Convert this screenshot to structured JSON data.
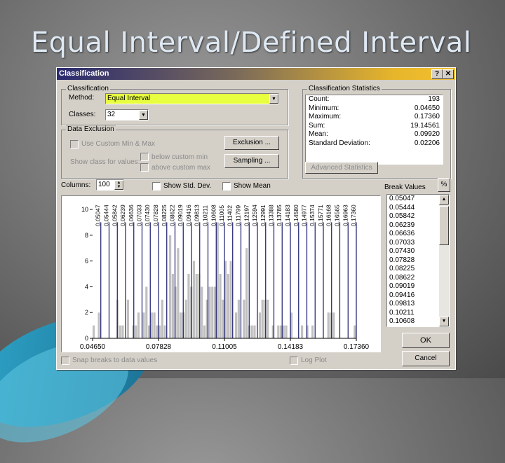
{
  "slide_title": "Equal Interval/Defined Interval",
  "dialog": {
    "title": "Classification",
    "help_label": "?",
    "close_label": "✕",
    "classification_group": "Classification",
    "method_label": "Method:",
    "method_value": "Equal Interval",
    "classes_label": "Classes:",
    "classes_value": "32",
    "exclusion_group": "Data Exclusion",
    "use_custom_minmax": "Use Custom Min & Max",
    "show_class_label": "Show class for values:",
    "below_custom_min": "below custom min",
    "above_custom_max": "above custom max",
    "exclusion_button": "Exclusion ...",
    "sampling_button": "Sampling ...",
    "stats_group": "Classification Statistics",
    "stats": [
      {
        "label": "Count:",
        "value": "193"
      },
      {
        "label": "Minimum:",
        "value": "0.04650"
      },
      {
        "label": "Maximum:",
        "value": "0.17360"
      },
      {
        "label": "Sum:",
        "value": "19.14561"
      },
      {
        "label": "Mean:",
        "value": "0.09920"
      },
      {
        "label": "Standard Deviation:",
        "value": "0.02206"
      }
    ],
    "advanced_stats_button": "Advanced Statistics",
    "columns_label": "Columns:",
    "columns_value": "100",
    "show_std_dev": "Show Std. Dev.",
    "show_mean": "Show Mean",
    "break_values_label": "Break Values",
    "percent_button": "%",
    "break_values_list": [
      "0.05047",
      "0.05444",
      "0.05842",
      "0.06239",
      "0.06636",
      "0.07033",
      "0.07430",
      "0.07828",
      "0.08225",
      "0.08622",
      "0.09019",
      "0.09416",
      "0.09813",
      "0.10211",
      "0.10608"
    ],
    "snap_breaks": "Snap breaks to data values",
    "log_plot": "Log Plot",
    "ok_button": "OK",
    "cancel_button": "Cancel"
  },
  "colors": {
    "bar": "#c0c0c0",
    "break_line": "#1a1a6e",
    "method_bg": "#e8ff40"
  },
  "chart_data": {
    "type": "bar",
    "title": "",
    "xlabel": "",
    "ylabel": "",
    "xlim": [
      0.0465,
      0.1736
    ],
    "ylim": [
      0,
      10
    ],
    "x_tick_labels": [
      "0.04650",
      "0.07828",
      "0.11005",
      "0.14183",
      "0.17360"
    ],
    "y_tick_labels": [
      "0",
      "2",
      "4",
      "6",
      "8",
      "10"
    ],
    "bins": 100,
    "values": [
      1,
      0,
      2,
      0,
      0,
      0,
      0,
      0,
      0,
      3,
      1,
      1,
      0,
      3,
      0,
      1,
      1,
      2,
      0,
      2,
      4,
      1,
      2,
      2,
      1,
      1,
      3,
      1,
      0,
      8,
      5,
      4,
      7,
      2,
      2,
      3,
      5,
      4,
      6,
      5,
      5,
      4,
      1,
      3,
      4,
      4,
      4,
      9,
      5,
      3,
      6,
      5,
      6,
      0,
      2,
      3,
      0,
      3,
      7,
      1,
      1,
      1,
      0,
      2,
      3,
      3,
      3,
      0,
      1,
      0,
      1,
      1,
      1,
      1,
      0,
      2,
      0,
      0,
      0,
      1,
      0,
      1,
      0,
      1,
      0,
      0,
      0,
      0,
      0,
      2,
      2,
      2,
      0,
      0,
      0,
      0,
      0,
      0,
      0,
      1
    ],
    "breaks": [
      "0.05047",
      "0.05444",
      "0.05842",
      "0.06239",
      "0.06636",
      "0.07033",
      "0.07430",
      "0.07828",
      "0.08225",
      "0.08622",
      "0.09019",
      "0.09416",
      "0.09813",
      "0.10211",
      "0.10608",
      "0.11005",
      "0.11402",
      "0.11799",
      "0.12197",
      "0.12594",
      "0.12991",
      "0.13388",
      "0.13785",
      "0.14183",
      "0.14580",
      "0.14977",
      "0.15374",
      "0.15771",
      "0.16168",
      "0.16565",
      "0.16963",
      "0.17360"
    ]
  }
}
